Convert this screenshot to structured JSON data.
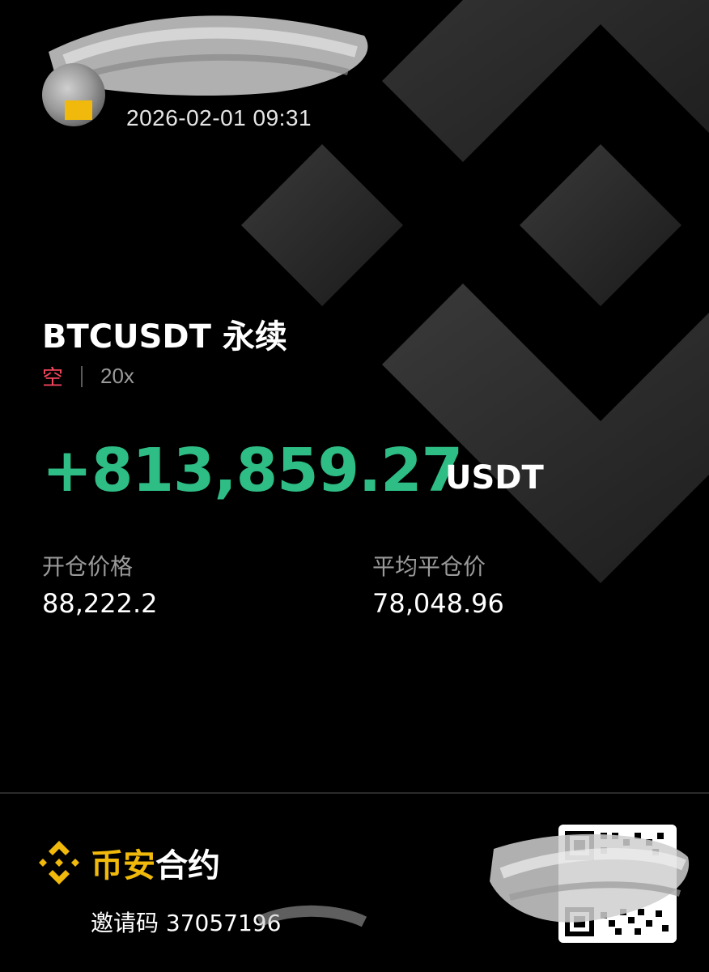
{
  "header": {
    "timestamp": "2026-02-01 09:31"
  },
  "position": {
    "pair": "BTCUSDT 永续",
    "side": "空",
    "leverage": "20x",
    "pnl": "+813,859.27",
    "pnl_unit": "USDT"
  },
  "stats": {
    "entry_price_label": "开仓价格",
    "entry_price": "88,222.2",
    "avg_close_label": "平均平仓价",
    "avg_close": "78,048.96"
  },
  "footer": {
    "brand_part1": "币安",
    "brand_part2": "合约",
    "invite_label": "邀请码",
    "invite_code": "37057196"
  },
  "colors": {
    "short": "#f6465d",
    "profit": "#2ebd85",
    "brand": "#f0b90b",
    "background": "#000000"
  },
  "icons": {
    "avatar": "avatar",
    "brand": "binance-logo-icon",
    "background": "binance-logo-watermark",
    "qr": "qr-code"
  }
}
